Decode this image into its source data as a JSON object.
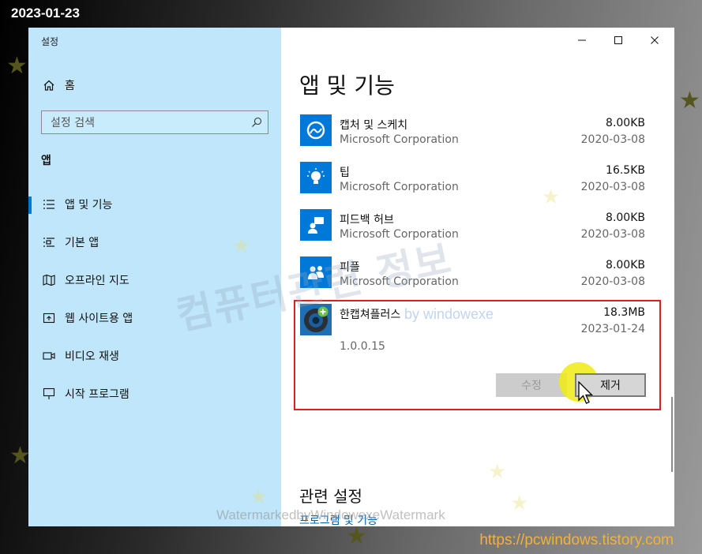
{
  "overlay": {
    "date": "2023-01-23",
    "url": "https://pcwindows.tistory.com",
    "watermark_main": "컴퓨터관련 정보",
    "watermark_by": "by windowexe",
    "watermark_bottom": "WatermarkedbyWindowexeWatermark"
  },
  "window": {
    "title": "설정",
    "caption_buttons": {
      "minimize": "—",
      "maximize": "☐",
      "close": "✕"
    }
  },
  "sidebar": {
    "home_label": "홈",
    "search_placeholder": "설정 검색",
    "section_title": "앱",
    "items": [
      {
        "label": "앱 및 기능",
        "icon": "list-icon",
        "active": true
      },
      {
        "label": "기본 앱",
        "icon": "default-apps-icon"
      },
      {
        "label": "오프라인 지도",
        "icon": "map-icon"
      },
      {
        "label": "웹 사이트용 앱",
        "icon": "website-apps-icon"
      },
      {
        "label": "비디오 재생",
        "icon": "video-icon"
      },
      {
        "label": "시작 프로그램",
        "icon": "startup-icon"
      }
    ]
  },
  "main": {
    "title": "앱 및 기능",
    "apps": [
      {
        "name": "캡처 및 스케치",
        "publisher": "Microsoft Corporation",
        "size": "8.00KB",
        "date": "2020-03-08",
        "icon": "snip-sketch-icon"
      },
      {
        "name": "팁",
        "publisher": "Microsoft Corporation",
        "size": "16.5KB",
        "date": "2020-03-08",
        "icon": "tips-icon"
      },
      {
        "name": "피드백 허브",
        "publisher": "Microsoft Corporation",
        "size": "8.00KB",
        "date": "2020-03-08",
        "icon": "feedback-hub-icon"
      },
      {
        "name": "피플",
        "publisher": "Microsoft Corporation",
        "size": "8.00KB",
        "date": "2020-03-08",
        "icon": "people-icon"
      }
    ],
    "selected_app": {
      "name": "한캡쳐플러스",
      "size": "18.3MB",
      "date": "2023-01-24",
      "version": "1.0.0.15",
      "icon": "hancapture-icon",
      "modify_label": "수정",
      "uninstall_label": "제거"
    },
    "related_title": "관련 설정",
    "related_link": "프로그램 및 기능"
  },
  "colors": {
    "sidebar_bg": "#bfe6fa",
    "accent": "#0078d7",
    "highlight_frame": "#e01e1e",
    "url_text": "#f2b23a"
  }
}
